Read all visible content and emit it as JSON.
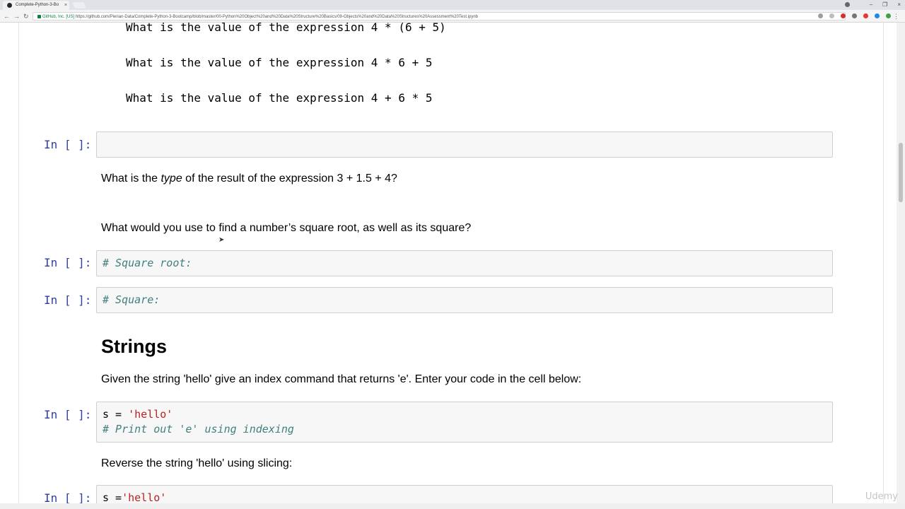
{
  "browser": {
    "tab_title": "Complete-Python-3-Bo",
    "tab_close": "×",
    "window_controls": [
      "–",
      "❐",
      "×"
    ],
    "address_secure": "GitHub, Inc. [US]",
    "address_url": "https://github.com/Pierian-Data/Complete-Python-3-Bootcamp/blob/master/00-Python%20Object%20and%20Data%20Structure%20Basics/09-Objects%20and%20Data%20Structures%20Assessment%20Test.ipynb",
    "nav": {
      "back": "←",
      "forward": "→",
      "reload": "↻"
    },
    "menu": "⋮"
  },
  "notebook": {
    "expressions": [
      "What is the value of the expression 4 * (6 + 5)",
      "What is the value of the expression 4 * 6 + 5",
      "What is the value of the expression 4 + 6 * 5"
    ],
    "prompt": "In [ ]:",
    "type_question": {
      "before": "What is the ",
      "emph": "type",
      "after": " of the result of the expression 3 + 1.5 + 4?"
    },
    "sqrt_question": "What would you use to find a number’s square root, as well as its square?",
    "cell_sqrt_comment": "# Square root:",
    "cell_square_comment": "# Square:",
    "strings_heading": "Strings",
    "strings_index_question": "Given the string 'hello' give an index command that returns 'e'. Enter your code in the cell below:",
    "cell_hello": {
      "var": "s = ",
      "str": "'hello'",
      "comment": "# Print out 'e' using indexing"
    },
    "reverse_question": "Reverse the string 'hello' using slicing:",
    "cell_reverse": {
      "var": "s =",
      "str": "'hello'"
    }
  },
  "watermark": "Udemy",
  "colors": {
    "prompt": "#303f9f",
    "comment": "#408080",
    "string": "#ba2121",
    "cell_bg": "#f7f7f7"
  }
}
